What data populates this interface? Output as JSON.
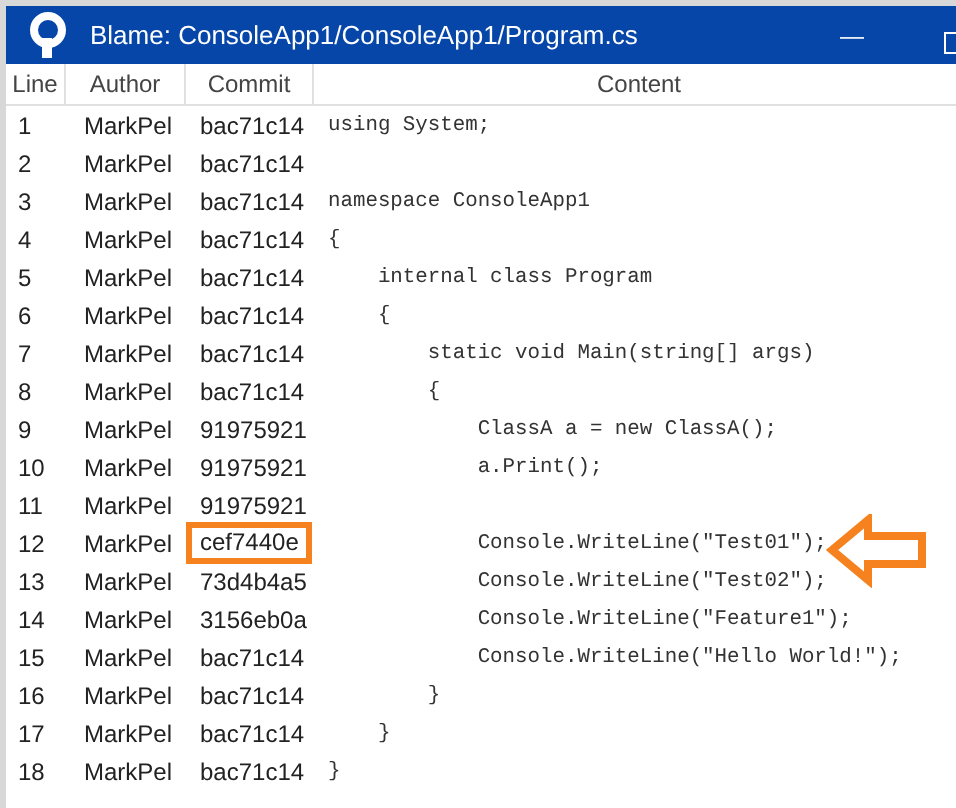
{
  "window": {
    "title": "Blame: ConsoleApp1/ConsoleApp1/Program.cs",
    "minimize": "—"
  },
  "table": {
    "columns": [
      "Line",
      "Author",
      "Commit",
      "Content"
    ],
    "rows": [
      {
        "line": "1",
        "author": "MarkPel",
        "commit": "bac71c14",
        "content": "using System;",
        "marked": false
      },
      {
        "line": "2",
        "author": "MarkPel",
        "commit": "bac71c14",
        "content": "",
        "marked": false
      },
      {
        "line": "3",
        "author": "MarkPel",
        "commit": "bac71c14",
        "content": "namespace ConsoleApp1",
        "marked": false
      },
      {
        "line": "4",
        "author": "MarkPel",
        "commit": "bac71c14",
        "content": "{",
        "marked": false
      },
      {
        "line": "5",
        "author": "MarkPel",
        "commit": "bac71c14",
        "content": "    internal class Program",
        "marked": false
      },
      {
        "line": "6",
        "author": "MarkPel",
        "commit": "bac71c14",
        "content": "    {",
        "marked": false
      },
      {
        "line": "7",
        "author": "MarkPel",
        "commit": "bac71c14",
        "content": "        static void Main(string[] args)",
        "marked": false
      },
      {
        "line": "8",
        "author": "MarkPel",
        "commit": "bac71c14",
        "content": "        {",
        "marked": false
      },
      {
        "line": "9",
        "author": "MarkPel",
        "commit": "91975921",
        "content": "            ClassA a = new ClassA();",
        "marked": false
      },
      {
        "line": "10",
        "author": "MarkPel",
        "commit": "91975921",
        "content": "            a.Print();",
        "marked": false
      },
      {
        "line": "11",
        "author": "MarkPel",
        "commit": "91975921",
        "content": "",
        "marked": false
      },
      {
        "line": "12",
        "author": "MarkPel",
        "commit": "cef7440e",
        "content": "            Console.WriteLine(\"Test01\");",
        "marked": true
      },
      {
        "line": "13",
        "author": "MarkPel",
        "commit": "73d4b4a5",
        "content": "            Console.WriteLine(\"Test02\");",
        "marked": false
      },
      {
        "line": "14",
        "author": "MarkPel",
        "commit": "3156eb0a",
        "content": "            Console.WriteLine(\"Feature1\");",
        "marked": false
      },
      {
        "line": "15",
        "author": "MarkPel",
        "commit": "bac71c14",
        "content": "            Console.WriteLine(\"Hello World!\");",
        "marked": false
      },
      {
        "line": "16",
        "author": "MarkPel",
        "commit": "bac71c14",
        "content": "        }",
        "marked": false
      },
      {
        "line": "17",
        "author": "MarkPel",
        "commit": "bac71c14",
        "content": "    }",
        "marked": false
      },
      {
        "line": "18",
        "author": "MarkPel",
        "commit": "bac71c14",
        "content": "}",
        "marked": false
      }
    ]
  }
}
